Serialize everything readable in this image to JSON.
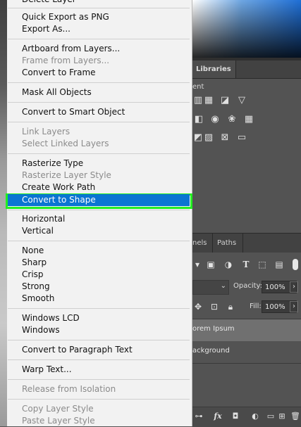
{
  "context_menu": {
    "items": [
      {
        "label": "Delete Layer",
        "enabled": true
      },
      {
        "label": "Quick Export as PNG",
        "enabled": true
      },
      {
        "label": "Export As...",
        "enabled": true
      },
      {
        "label": "Artboard from Layers...",
        "enabled": true
      },
      {
        "label": "Frame from Layers...",
        "enabled": false
      },
      {
        "label": "Convert to Frame",
        "enabled": true
      },
      {
        "label": "Mask All Objects",
        "enabled": true
      },
      {
        "label": "Convert to Smart Object",
        "enabled": true
      },
      {
        "label": "Link Layers",
        "enabled": false
      },
      {
        "label": "Select Linked Layers",
        "enabled": false
      },
      {
        "label": "Rasterize Type",
        "enabled": true
      },
      {
        "label": "Rasterize Layer Style",
        "enabled": false
      },
      {
        "label": "Create Work Path",
        "enabled": true
      },
      {
        "label": "Convert to Shape",
        "enabled": true,
        "selected": true
      },
      {
        "label": "Horizontal",
        "enabled": true
      },
      {
        "label": "Vertical",
        "enabled": true
      },
      {
        "label": "None",
        "enabled": true
      },
      {
        "label": "Sharp",
        "enabled": true
      },
      {
        "label": "Crisp",
        "enabled": true
      },
      {
        "label": "Strong",
        "enabled": true
      },
      {
        "label": "Smooth",
        "enabled": true
      },
      {
        "label": "Windows LCD",
        "enabled": true
      },
      {
        "label": "Windows",
        "enabled": true
      },
      {
        "label": "Convert to Paragraph Text",
        "enabled": true
      },
      {
        "label": "Warp Text...",
        "enabled": true
      },
      {
        "label": "Release from Isolation",
        "enabled": false
      },
      {
        "label": "Copy Layer Style",
        "enabled": false
      },
      {
        "label": "Paste Layer Style",
        "enabled": false
      }
    ]
  },
  "panels": {
    "libraries_tab": "Libraries",
    "adjustments_label_fragment": "ent",
    "channels_tab_fragment": "nels",
    "paths_tab": "Paths",
    "opacity_label": "Opacity:",
    "opacity_value": "100%",
    "fill_label": "Fill:",
    "fill_value": "100%",
    "layers": [
      {
        "name": "orem Ipsum",
        "selected": true
      },
      {
        "name": "ackground",
        "selected": false
      }
    ],
    "fx_label": "fx"
  },
  "colors": {
    "menu_background": "#f2f2f2",
    "selected_item": "#0a75d2",
    "highlight_outline": "#22ee22",
    "disabled_text": "#8b8b8b",
    "panel_background": "#535353"
  },
  "icons": {
    "adjustments": [
      "brightness-icon",
      "levels-icon",
      "curves-icon",
      "exposure-icon",
      "gradient-triangle-icon",
      "vibrance-icon",
      "hue-saturation-icon",
      "color-balance-icon",
      "black-white-icon",
      "photo-filter-icon",
      "channel-mixer-icon",
      "color-lookup-icon",
      "invert-icon",
      "posterize-icon",
      "threshold-icon",
      "gradient-map-icon",
      "selective-color-icon"
    ],
    "layer_filters": [
      "image-filter-icon",
      "adjustment-filter-icon",
      "type-filter-icon",
      "shape-filter-icon",
      "smart-object-filter-icon"
    ],
    "locks": [
      "lock-position-icon",
      "lock-artboard-icon",
      "lock-all-icon"
    ],
    "footer": [
      "link-icon",
      "fx-icon",
      "mask-icon",
      "adjustment-layer-icon",
      "group-icon",
      "new-layer-icon",
      "trash-icon"
    ]
  }
}
